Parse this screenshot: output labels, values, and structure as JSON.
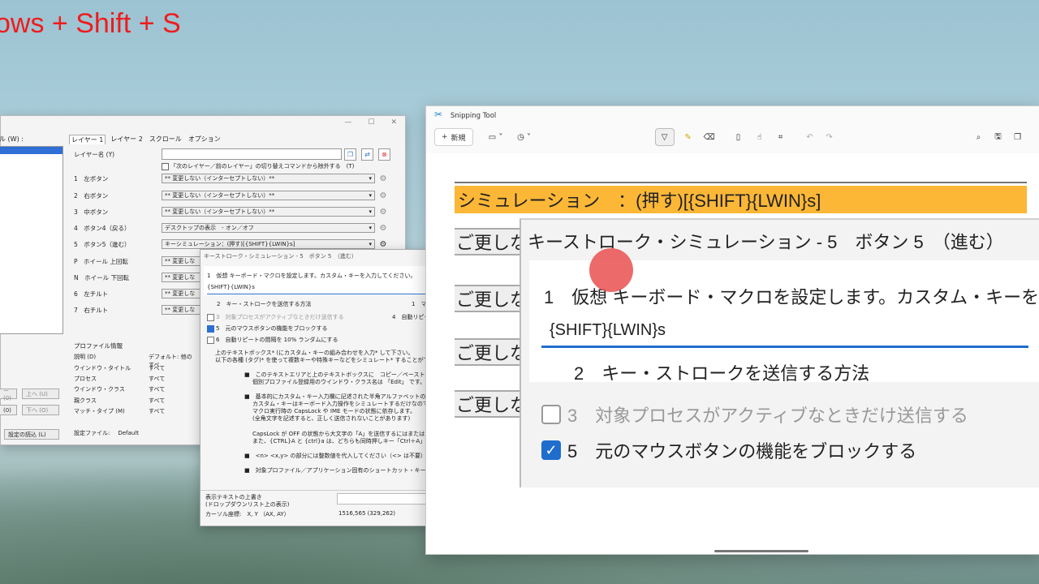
{
  "overlay": {
    "shortcut_text": "ows + Shift + S"
  },
  "main_window": {
    "list_label": "ル (W) :",
    "tabs": [
      "レイヤー 1",
      "レイヤー 2",
      "スクロール",
      "オプション"
    ],
    "layer_name_label": "レイヤー名 (Y)",
    "exclude_checkbox_label": "「次のレイヤー／前のレイヤー」の切り替えコマンドから除外する　(T)",
    "rows": [
      {
        "label": "1　左ボタン",
        "value": "** 変更しない（インターセプトしない）**"
      },
      {
        "label": "2　右ボタン",
        "value": "** 変更しない（インターセプトしない）**"
      },
      {
        "label": "3　中ボタン",
        "value": "** 変更しない（インターセプトしない）**"
      },
      {
        "label": "4　ボタン4（戻る）",
        "value": "デスクトップの表示　- オン／オフ"
      },
      {
        "label": "5　ボタン5（進む）",
        "value": "キーシミュレーション：(押す)[{SHIFT}{LWIN}s]"
      },
      {
        "label": "P　ホイール 上回転",
        "value": "** 変更しな"
      },
      {
        "label": "N　ホイール 下回転",
        "value": "** 変更しな"
      },
      {
        "label": "6　左チルト",
        "value": "** 変更しな"
      },
      {
        "label": "7　右チルト",
        "value": "** 変更しな"
      }
    ],
    "profile_title": "プロファイル情報",
    "profile_rows": [
      {
        "k": "説明 (D)",
        "v": "デフォルト: 他のすべ"
      },
      {
        "k": "ウインドウ・タイトル",
        "v": "すべて"
      },
      {
        "k": "プロセス",
        "v": "すべて"
      },
      {
        "k": "ウインドウ・クラス",
        "v": "すべて"
      },
      {
        "k": "親クラス",
        "v": "すべて"
      },
      {
        "k": "マッチ・タイプ (M)",
        "v": "すべて"
      }
    ],
    "nav": {
      "b1": "ー (0)",
      "up": "上へ (U)",
      "b2": "(0)",
      "down": "下へ (O)"
    },
    "load_settings": "設定の読込 (L)",
    "settings_file_label": "設定ファイル:",
    "settings_file_value": "Default"
  },
  "ks_small": {
    "title": "キーストローク・シミュレーション - 5　ボタン 5　（進む）",
    "step1": "1　仮想 キーボード・マクロを設定します。カスタム・キーを入力してください。",
    "input_value": "{SHIFT}{LWIN}s",
    "step2": "2　キー・ストロークを送信する方法",
    "col1": "1　マ",
    "opt3": "3　対象プロセスがアクティブなときだけ送信する",
    "opt4": "4　自動リピー",
    "opt5": "5　元のマウスボタンの機能をブロックする",
    "opt6": "6　自動リピートの間隔を 10% ランダムにする",
    "help1": "上のテキストボックス* (にカスタム・キーの組み合わせを入力* して下さい。",
    "help2": "以下の各種 (タグ)* を使って複数キーや特殊キーなどをシミュレート* することがで",
    "b1": "このテキストエリアと上のテキストボックスに　コピー／ペースト　などの",
    "b1b": "個別プロファイル登録用のウインドウ・クラス名は 「Edit」 です。",
    "b2": "基本的にカスタム・キー入力欄に記述された半角アルファベットの大",
    "b2b": "カスタム・キーはキーボード入力操作をシミュレートするだけなので、",
    "b2c": "マクロ実行時の CapsLock や IME モードの状態に依存します。",
    "b2d": "(全角文字を記述すると、正しく送信されないことがあります)",
    "b3": "CapsLock が OFF の状態から大文字の「A」を送信するにはまたは",
    "b3b": "また、{CTRL}A と {ctrl}a は、どちらも同時押しキー「Ctrl＋A」",
    "b4": "<n> <x,y> の部分には整数値を代入してください（<> は不要）",
    "b5": "対象プロファイル／アプリケーション固有のショートカット・キー操作な",
    "footer1": "表示テキストの上書き",
    "footer2": "(ドロップダウンリスト上の表示)",
    "coords_label": "カーソル座標:　X, Y （AX, AY）",
    "coords_value": "1516,565 (329,262)"
  },
  "snipping": {
    "app_title": "Snipping Tool",
    "new_label": "新規",
    "zoom": {
      "highlight_text": "シミュレーション　：(押す)[{SHIFT}{LWIN}s]",
      "stub_text": "ご更しな",
      "dialog_title": "キーストローク・シミュレーション - 5　ボタン 5　（進む）",
      "step1": "1　仮想 キーボード・マクロを設定します。カスタム・キーを入",
      "input_value": "{SHIFT}{LWIN}s",
      "step2": "2　キー・ストロークを送信する方法",
      "opt3": "3　対象プロセスがアクティブなときだけ送信する",
      "opt5": "5　元のマウスボタンの機能をブロックする"
    }
  },
  "colors": {
    "accent": "#1f6dcc",
    "highlight": "#fcb737",
    "overlay_red": "#ee1c1c"
  }
}
